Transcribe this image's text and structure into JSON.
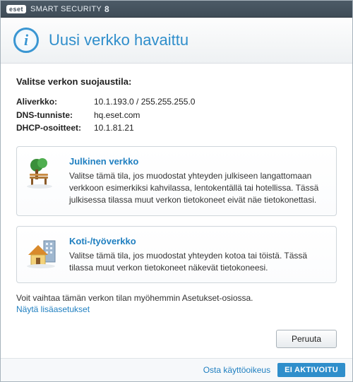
{
  "titlebar": {
    "brand": "eset",
    "product": "SMART SECURITY",
    "version": "8"
  },
  "header": {
    "title": "Uusi verkko havaittu"
  },
  "prompt": "Valitse verkon suojaustila:",
  "net": {
    "subnet_label": "Aliverkko:",
    "subnet_value": "10.1.193.0 / 255.255.255.0",
    "dns_label": "DNS-tunniste:",
    "dns_value": "hq.eset.com",
    "dhcp_label": "DHCP-osoitteet:",
    "dhcp_value": "10.1.81.21"
  },
  "options": {
    "public": {
      "title": "Julkinen verkko",
      "desc": "Valitse tämä tila, jos muodostat yhteyden julkiseen langattomaan verkkoon esimerkiksi kahvilassa, lentokentällä tai hotellissa. Tässä julkisessa tilassa muut verkon tietokoneet eivät näe tietokonettasi."
    },
    "home": {
      "title": "Koti-/työverkko",
      "desc": "Valitse tämä tila, jos muodostat yhteyden kotoa tai töistä. Tässä tilassa muut verkon tietokoneet näkevät tietokoneesi."
    }
  },
  "note": "Voit vaihtaa tämän verkon tilan myöhemmin Asetukset-osiossa.",
  "advanced_link": "Näytä lisäasetukset",
  "buttons": {
    "cancel": "Peruuta"
  },
  "footer": {
    "buy": "Osta käyttöoikeus",
    "status": "EI AKTIVOITU"
  }
}
